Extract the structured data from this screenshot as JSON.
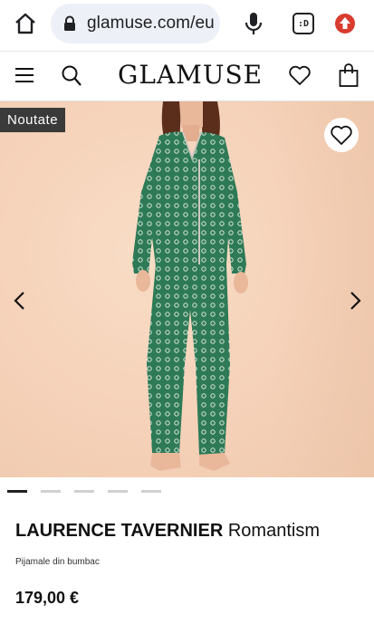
{
  "browser": {
    "url": "glamuse.com/eu",
    "tabs_label": ":D",
    "accent_update": "#d93b2f",
    "url_bg": "#edf0f6"
  },
  "header": {
    "brand": "GLAMUSE",
    "icons": [
      "menu-icon",
      "search-icon",
      "heart-icon",
      "shopping-bag-icon"
    ]
  },
  "gallery": {
    "badge": "Noutate",
    "slide_count": 5,
    "active_slide": 1,
    "icons": [
      "chevron-left-icon",
      "chevron-right-icon",
      "heart-icon"
    ]
  },
  "product": {
    "brand": "LAURENCE TAVERNIER",
    "collection": "Romantism",
    "subtitle": "Pijamale din bumbac",
    "price": "179,00 €"
  },
  "colors": {
    "pajama_green": "#2e7a57",
    "background_peach": "#f6d3bb",
    "badge_bg": "#3a3a3a"
  }
}
